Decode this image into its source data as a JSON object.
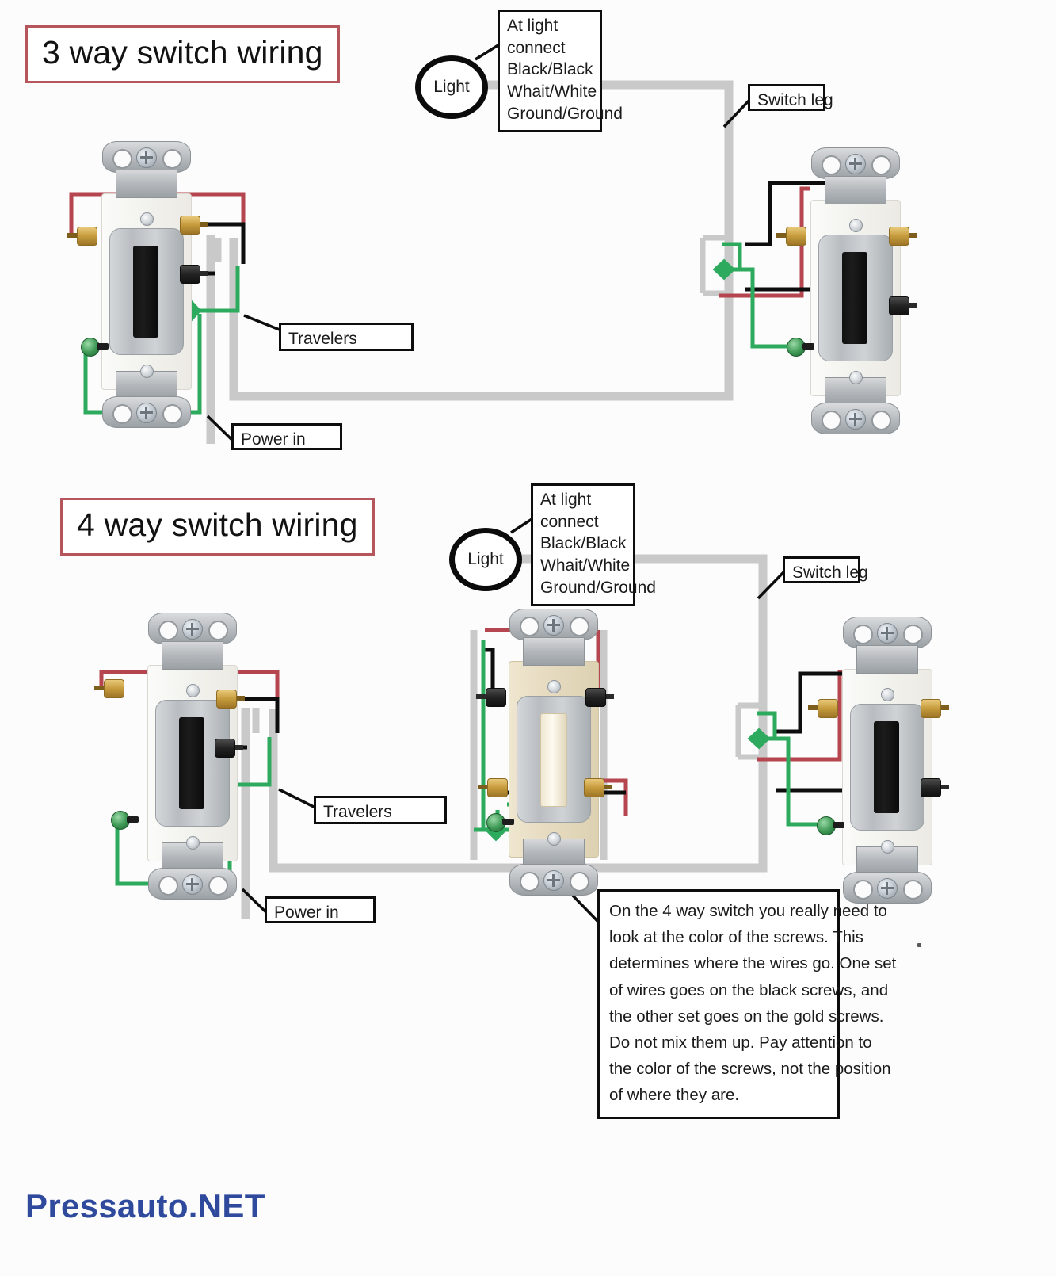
{
  "page": {
    "brand": "Pressauto.NET",
    "colors": {
      "wire_black": "#0d0d0d",
      "wire_red": "#b5454e",
      "wire_green": "#2eaa5e",
      "cable_gray": "#c9c9c9",
      "title_border": "#b4565c",
      "brand_blue": "#2f4a9c"
    }
  },
  "sections": [
    {
      "id": "three-way",
      "title": "3 way switch wiring",
      "light": {
        "label": "Light"
      },
      "light_note": {
        "lines": [
          "At light connect",
          "Black/Black",
          "Whait/White",
          "Ground/Ground"
        ]
      },
      "labels": {
        "switch_leg": "Switch leg",
        "travelers": "Travelers",
        "power_in": "Power in"
      },
      "switches": [
        {
          "name": "left-3way-switch",
          "color": "white",
          "toggle": "black"
        },
        {
          "name": "right-3way-switch",
          "color": "white",
          "toggle": "black"
        }
      ]
    },
    {
      "id": "four-way",
      "title": "4 way switch wiring",
      "light": {
        "label": "Light"
      },
      "light_note": {
        "lines": [
          "At light connect",
          "Black/Black",
          "Whait/White",
          "Ground/Ground"
        ]
      },
      "labels": {
        "switch_leg": "Switch leg",
        "travelers": "Travelers",
        "power_in": "Power in"
      },
      "switches": [
        {
          "name": "left-4way-switch",
          "color": "white",
          "toggle": "black"
        },
        {
          "name": "middle-4way-switch",
          "color": "ivory",
          "toggle": "ivory"
        },
        {
          "name": "right-4way-switch",
          "color": "white",
          "toggle": "black"
        }
      ],
      "note": {
        "lines": [
          "On the 4 way switch you really need to",
          "look at the color of the screws. This",
          "determines where the wires go. One set",
          "of wires goes on the black screws, and",
          "the other set goes on the gold screws.",
          "Do not mix them up. Pay attention to",
          "the color of the screws, not the position",
          "of where they are."
        ]
      }
    }
  ]
}
